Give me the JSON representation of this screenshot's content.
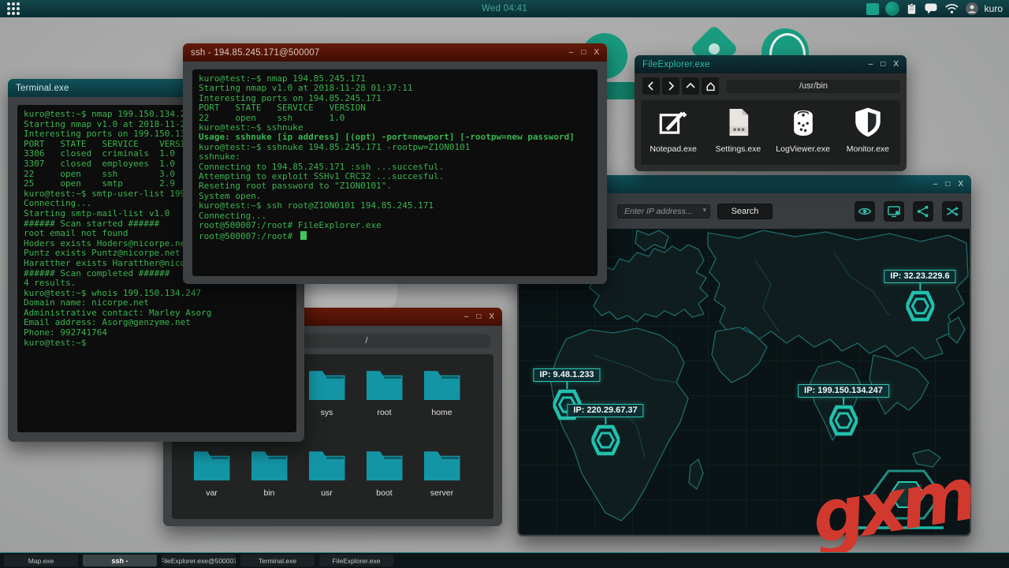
{
  "topbar": {
    "clock": "Wed 04:41",
    "username": "kuro"
  },
  "window_controls": {
    "minimize": "–",
    "maximize": "□",
    "close": "X"
  },
  "windows": {
    "ssh": {
      "title": "ssh - 194.85.245.171@500007",
      "lines": [
        "kuro@test:~$ nmap 194.85.245.171",
        "",
        "Starting nmap v1.0 at 2018-11-28 01:37:11",
        "Interesting ports on 194.85.245.171",
        "",
        "PORT   STATE   SERVICE   VERSION",
        "22     open    ssh       1.0",
        "",
        "kuro@test:~$ sshnuke",
        "Usage: sshnuke [ip address] [(opt) -port=newport] [-rootpw=new password]",
        "kuro@test:~$ sshnuke 194.85.245.171 -rootpw=Z1ON0101",
        "sshnuke:",
        "Connecting to 194.85.245.171 :ssh ...succesful.",
        "Attempting to exploit SSHv1 CRC32 ...succesful.",
        "Reseting root password to \"Z1ON0101\".",
        "System open.",
        "kuro@test:~$ ssh root@Z1ON0101 194.85.245.171",
        "Connecting...",
        "root@500007:/root# FileExplorer.exe",
        "root@500007:/root# "
      ]
    },
    "terminal": {
      "title": "Terminal.exe",
      "lines": [
        "kuro@test:~$ nmap 199.150.134.247",
        "",
        "Starting nmap v1.0 at 2018-11-2",
        "Interesting ports on 199.150.134.247",
        "",
        "PORT   STATE   SERVICE    VERSION",
        "3306   closed  criminals  1.0",
        "3307   closed  employees  1.0",
        "22     open    ssh        3.0",
        "25     open    smtp       2.9",
        "",
        "kuro@test:~$ smtp-user-list 199.150.134.247",
        "Connecting...",
        "",
        "Starting smtp-mail-list v1.0",
        "",
        "###### Scan started ######",
        "root email not found",
        "Hoders exists Hoders@nicorpe.net",
        "Puntz exists Puntz@nicorpe.net",
        "Haratther exists Haratther@nicorpe.net",
        "###### Scan completed ######",
        "4 results.",
        "",
        "kuro@test:~$ whois 199.150.134.247",
        "",
        "Domain name: nicorpe.net",
        "Administrative contact: Marley Asorg",
        "Email address: Asorg@genzyme.net",
        "Phone: 992741764",
        "kuro@test:~$"
      ]
    },
    "file_explorer_local": {
      "title": "FileExplorer.exe",
      "address": "/usr/bin",
      "items": [
        "Notepad.exe",
        "Settings.exe",
        "LogViewer.exe",
        "Monitor.exe"
      ]
    },
    "file_explorer_remote": {
      "address": "/",
      "folders_row1": [
        "sys",
        "root",
        "home"
      ],
      "folders_row2": [
        "var",
        "bin",
        "usr",
        "boot",
        "server"
      ]
    },
    "map": {
      "search_placeholder": "Enter IP address...",
      "search_button": "Search",
      "nodes": [
        {
          "ip": "IP: 32.23.229.6"
        },
        {
          "ip": "IP: 9.48.1.233"
        },
        {
          "ip": "IP: 220.29.67.37"
        },
        {
          "ip": "IP: 199.150.134.247"
        }
      ]
    }
  },
  "taskbar": {
    "items": [
      "Map.exe",
      "ssh -",
      "FileExplorer.exe@500007",
      "Terminal.exe",
      "FileExplorer.exe"
    ]
  },
  "watermark": "gxm",
  "colors": {
    "accent_teal": "#1fb3a2",
    "terminal_green": "#3bb350",
    "remote_titlebar_red": "#5a1407",
    "watermark_red": "#d2392e"
  }
}
